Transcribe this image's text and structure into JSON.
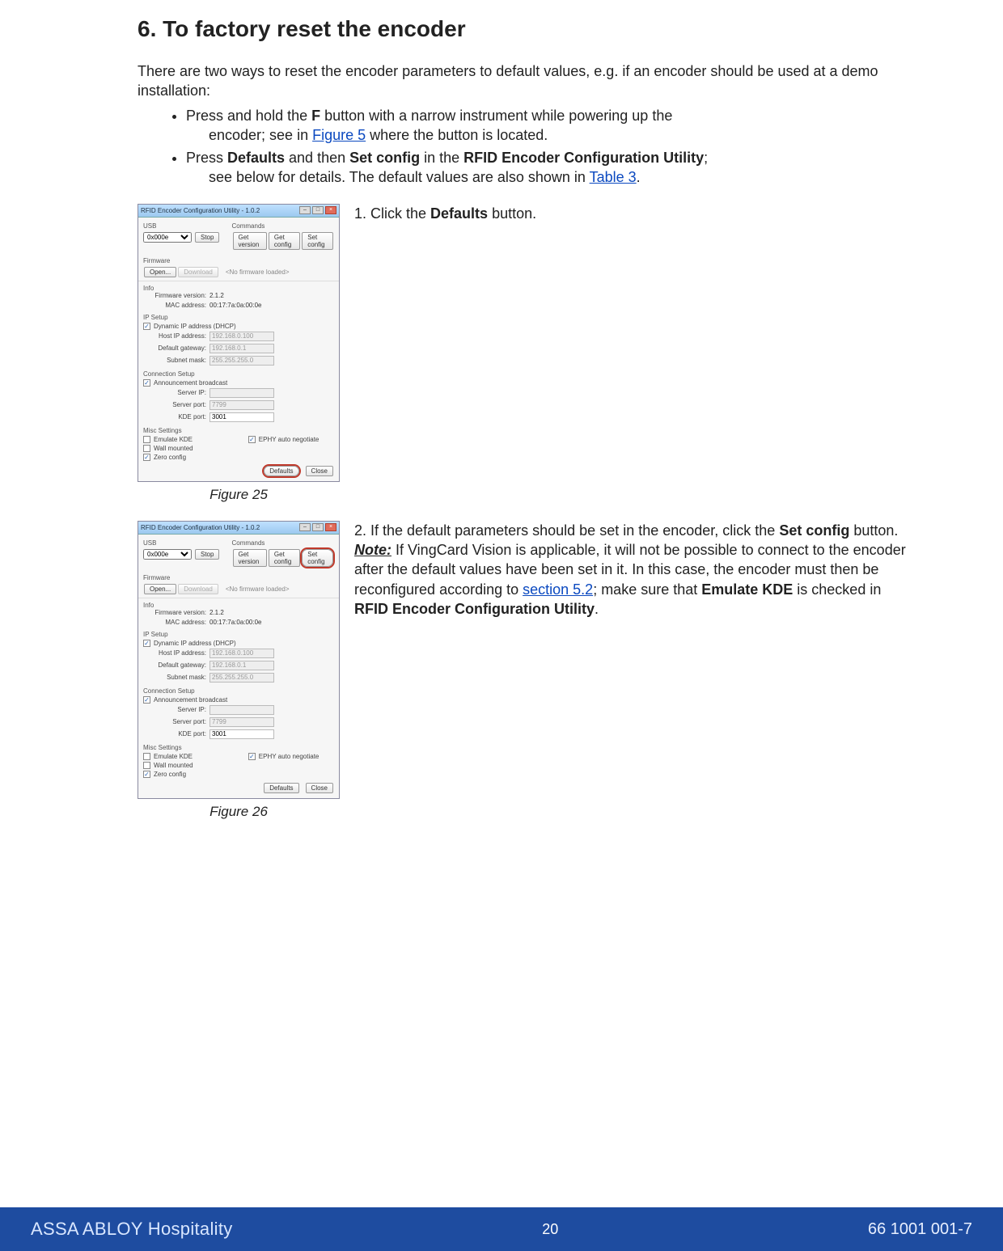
{
  "section": {
    "title": "6. To factory reset the encoder"
  },
  "intro": "There are two ways to reset the encoder parameters to default values, e.g. if an encoder should be used at a demo installation:",
  "bullets": {
    "b1a": "Press and hold the ",
    "b1b": "F",
    "b1c": " button with a narrow instrument while powering up the",
    "b1d": "encoder; see in ",
    "b1e": "Figure 5",
    "b1f": " where the button is located.",
    "b2a": "Press ",
    "b2b": "Defaults",
    "b2c": " and then ",
    "b2d": "Set config",
    "b2e": " in the ",
    "b2f": "RFID Encoder Configuration Utility",
    "b2g": ";",
    "b2h": "see below for details. The default values are also shown in ",
    "b2i": "Table 3",
    "b2j": "."
  },
  "step1": {
    "n": "1. ",
    "a": "Click the ",
    "b": "Defaults",
    "c": " button."
  },
  "step2": {
    "n": "2. ",
    "a": "If the default parameters should be set in the encoder, click the ",
    "b": "Set config",
    "c": " button. ",
    "note": "Note:",
    "d": " If VingCard Vision is applicable, it will not be possible to connect to the encoder after the default values have been set in it. In this case, the encoder must then be reconfigured according to ",
    "link": "section 5.2",
    "e": "; make sure that ",
    "f": "Emulate KDE",
    "g": " is checked in ",
    "h": "RFID Encoder Configuration Utility",
    "i": "."
  },
  "captions": {
    "f25": "Figure 25",
    "f26": "Figure 26"
  },
  "miniwin": {
    "title": "RFID Encoder Configuration Utility - 1.0.2",
    "usb": {
      "label": "USB",
      "device": "0x000e",
      "stop": "Stop"
    },
    "cmds": {
      "label": "Commands",
      "getver": "Get version",
      "getcfg": "Get config",
      "setcfg": "Set config"
    },
    "fw": {
      "label": "Firmware",
      "open": "Open...",
      "download": "Download",
      "status": "<No firmware loaded>"
    },
    "info": {
      "label": "Info",
      "fwver_l": "Firmware version:",
      "fwver_v": "2.1.2",
      "mac_l": "MAC address:",
      "mac_v": "00:17:7a:0a:00:0e"
    },
    "ip": {
      "label": "IP Setup",
      "dhcp": "Dynamic IP address (DHCP)",
      "hostip_l": "Host IP address:",
      "hostip_v": "192.168.0.100",
      "gw_l": "Default gateway:",
      "gw_v": "192.168.0.1",
      "mask_l": "Subnet mask:",
      "mask_v": "255.255.255.0"
    },
    "conn": {
      "label": "Connection Setup",
      "bcast": "Announcement broadcast",
      "srvip_l": "Server IP:",
      "srvport_l": "Server port:",
      "srvport_v": "7799",
      "kdeport_l": "KDE port:",
      "kdeport_v": "3001"
    },
    "misc": {
      "label": "Misc Settings",
      "emulate": "Emulate KDE",
      "wall": "Wall mounted",
      "zero": "Zero config",
      "ephy": "EPHY auto negotiate"
    },
    "footer": {
      "defaults": "Defaults",
      "close": "Close"
    }
  },
  "footer": {
    "brand": "ASSA ABLOY Hospitality",
    "page": "20",
    "docid": "66 1001 001-7"
  }
}
